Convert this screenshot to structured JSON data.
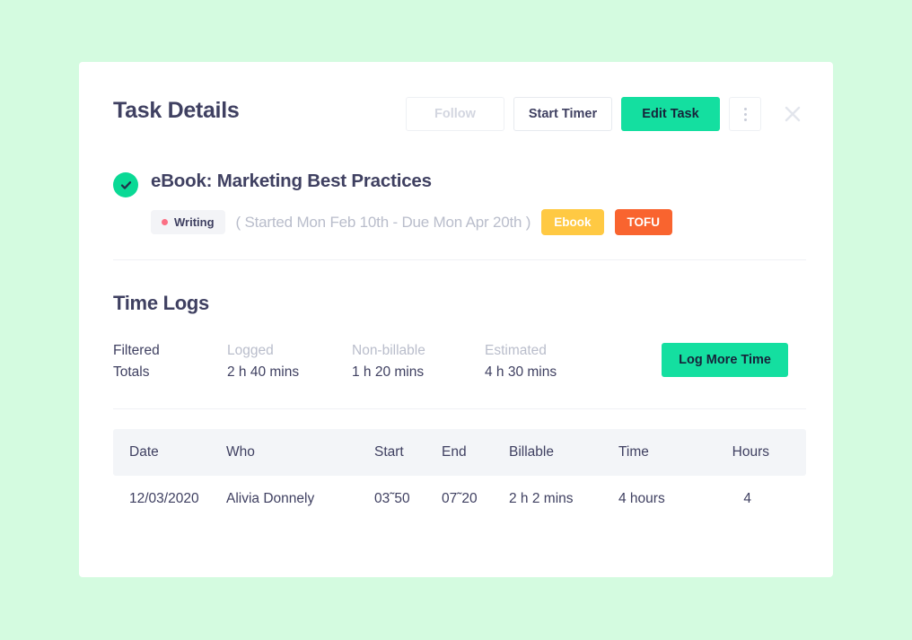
{
  "header": {
    "title": "Task Details",
    "actions": {
      "follow_label": "Follow",
      "start_timer_label": "Start Timer",
      "edit_task_label": "Edit Task",
      "kebab_icon": "more-vertical-icon",
      "close_icon": "close-icon"
    }
  },
  "task": {
    "complete_icon": "check-circle-icon",
    "title": "eBook: Marketing Best Practices",
    "status": {
      "label": "Writing",
      "dot_color": "#fb6f84"
    },
    "date_range": "( Started Mon Feb 10th - Due Mon Apr 20th )",
    "tags": [
      {
        "label": "Ebook",
        "color": "#ffc943"
      },
      {
        "label": "TOFU",
        "color": "#f9642f"
      }
    ]
  },
  "time_logs": {
    "section_title": "Time Logs",
    "totals": {
      "filtered_line1": "Filtered",
      "filtered_line2": "Totals",
      "logged_label": "Logged",
      "logged_value": "2 h 40 mins",
      "nonbillable_label": "Non-billable",
      "nonbillable_value": "1 h 20 mins",
      "estimated_label": "Estimated",
      "estimated_value": "4 h 30 mins"
    },
    "log_more_time_label": "Log More Time",
    "table": {
      "columns": [
        "Date",
        "Who",
        "Start",
        "End",
        "Billable",
        "Time",
        "Hours"
      ],
      "rows": [
        {
          "date": "12/03/2020",
          "who": "Alivia Donnely",
          "start": "03˜50",
          "end": "07˜20",
          "billable": "2 h 2 mins",
          "time": "4 hours",
          "hours": "4"
        }
      ]
    }
  },
  "colors": {
    "background": "#d4fbe0",
    "card": "#ffffff",
    "accent_green": "#14dfa0",
    "check_green": "#0ad995",
    "text_dark": "#3f4061",
    "text_muted": "#b9bdcb"
  }
}
